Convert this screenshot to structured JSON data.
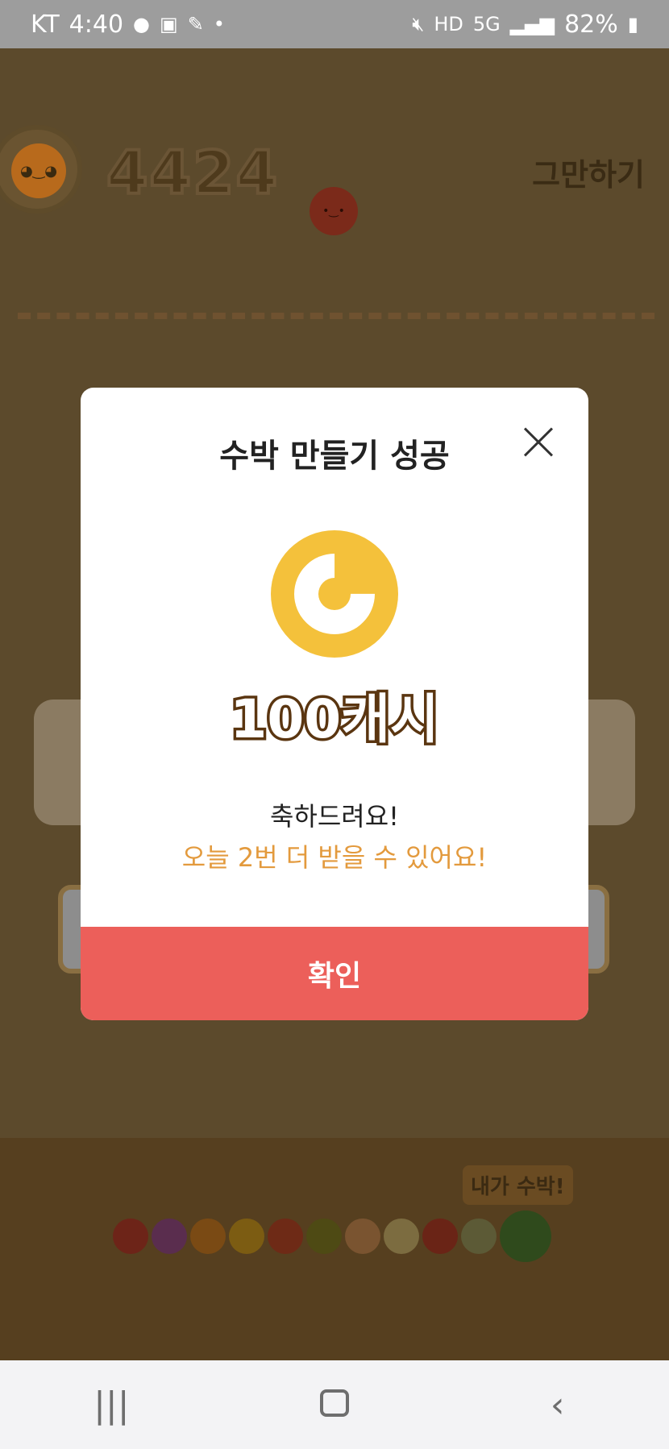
{
  "status_bar": {
    "carrier": "KT",
    "time": "4:40",
    "battery": "82%"
  },
  "game": {
    "score": "4424",
    "quit_label": "그만하기",
    "evolution_badge": "내가 수박!"
  },
  "modal": {
    "title": "수박 만들기 성공",
    "reward": "100캐시",
    "message_primary": "축하드려요!",
    "message_secondary": "오늘 2번 더 받을 수 있어요!",
    "confirm_label": "확인"
  },
  "colors": {
    "accent_red": "#ec5f5a",
    "coin_yellow": "#f4c13b",
    "highlight_orange": "#e39a3d"
  }
}
